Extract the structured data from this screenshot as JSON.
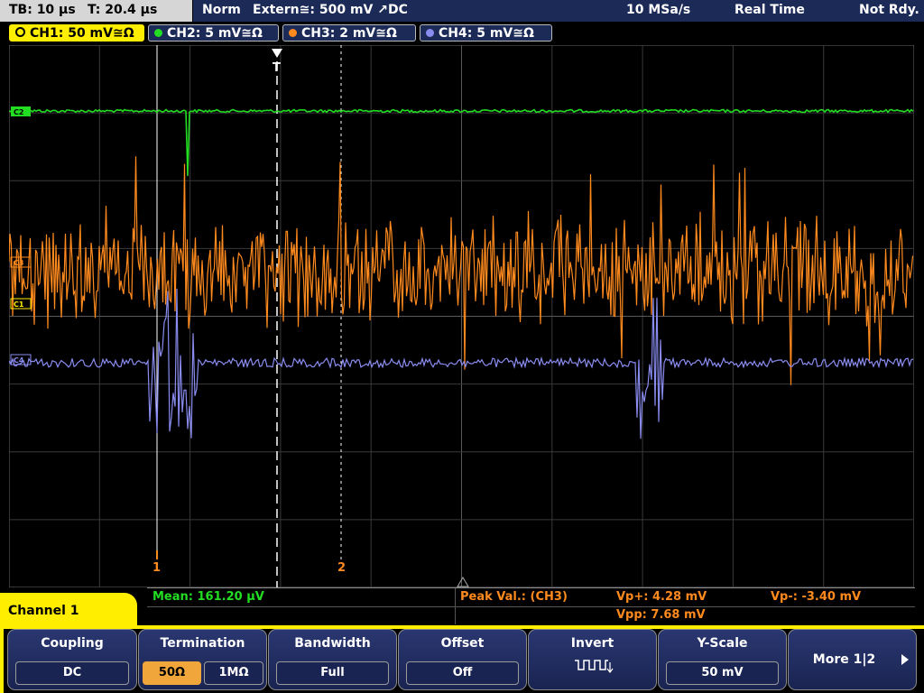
{
  "status": {
    "timebase": "TB: 10 µs",
    "trigger_time": "T: 20.4 µs",
    "mode": "Norm",
    "trigger_source": "Extern≅: 500 mV ↗DC",
    "sample_rate": "10 MSa/s",
    "acq_mode": "Real Time",
    "ready": "Not Rdy."
  },
  "channels": [
    {
      "label": "CH1: 50 mV≅Ω",
      "color": "#ffee00",
      "active": true
    },
    {
      "label": "CH2: 5 mV≅Ω",
      "color": "#22dd22",
      "active": false
    },
    {
      "label": "CH3: 2 mV≅Ω",
      "color": "#ff8a1e",
      "active": false
    },
    {
      "label": "CH4: 5 mV≅Ω",
      "color": "#8a8cf0",
      "active": false
    }
  ],
  "markers": {
    "trigger": "T",
    "cursor1": "1",
    "cursor2": "2",
    "ch1_tag": "C1",
    "ch2_tag": "C2",
    "ch3_tag": "C3",
    "ch4_tag": "C4"
  },
  "measurements": {
    "mean": "Mean: 161.20 µV",
    "peak_title": "Peak Val.:  (CH3)",
    "vp_plus": "Vp+: 4.28 mV",
    "vp_minus": "Vp-: -3.40 mV",
    "vpp": "Vpp: 7.68 mV"
  },
  "menu": {
    "title": "Channel 1",
    "coupling": {
      "title": "Coupling",
      "value": "DC"
    },
    "termination": {
      "title": "Termination",
      "options": [
        "50Ω",
        "1MΩ"
      ],
      "selected": "50Ω"
    },
    "bandwidth": {
      "title": "Bandwidth",
      "value": "Full"
    },
    "offset": {
      "title": "Offset",
      "value": "Off"
    },
    "invert": {
      "title": "Invert"
    },
    "yscale": {
      "title": "Y-Scale",
      "value": "50 mV"
    },
    "more": {
      "label": "More 1|2"
    }
  },
  "colors": {
    "grid": "#3a3a3a",
    "grid_axis": "#5a5a5a",
    "ch2": "#22dd22",
    "ch3": "#ff8a1e",
    "ch4": "#8a8cf0",
    "menu_bg": "#1c2a58",
    "highlight": "#ffee00"
  }
}
